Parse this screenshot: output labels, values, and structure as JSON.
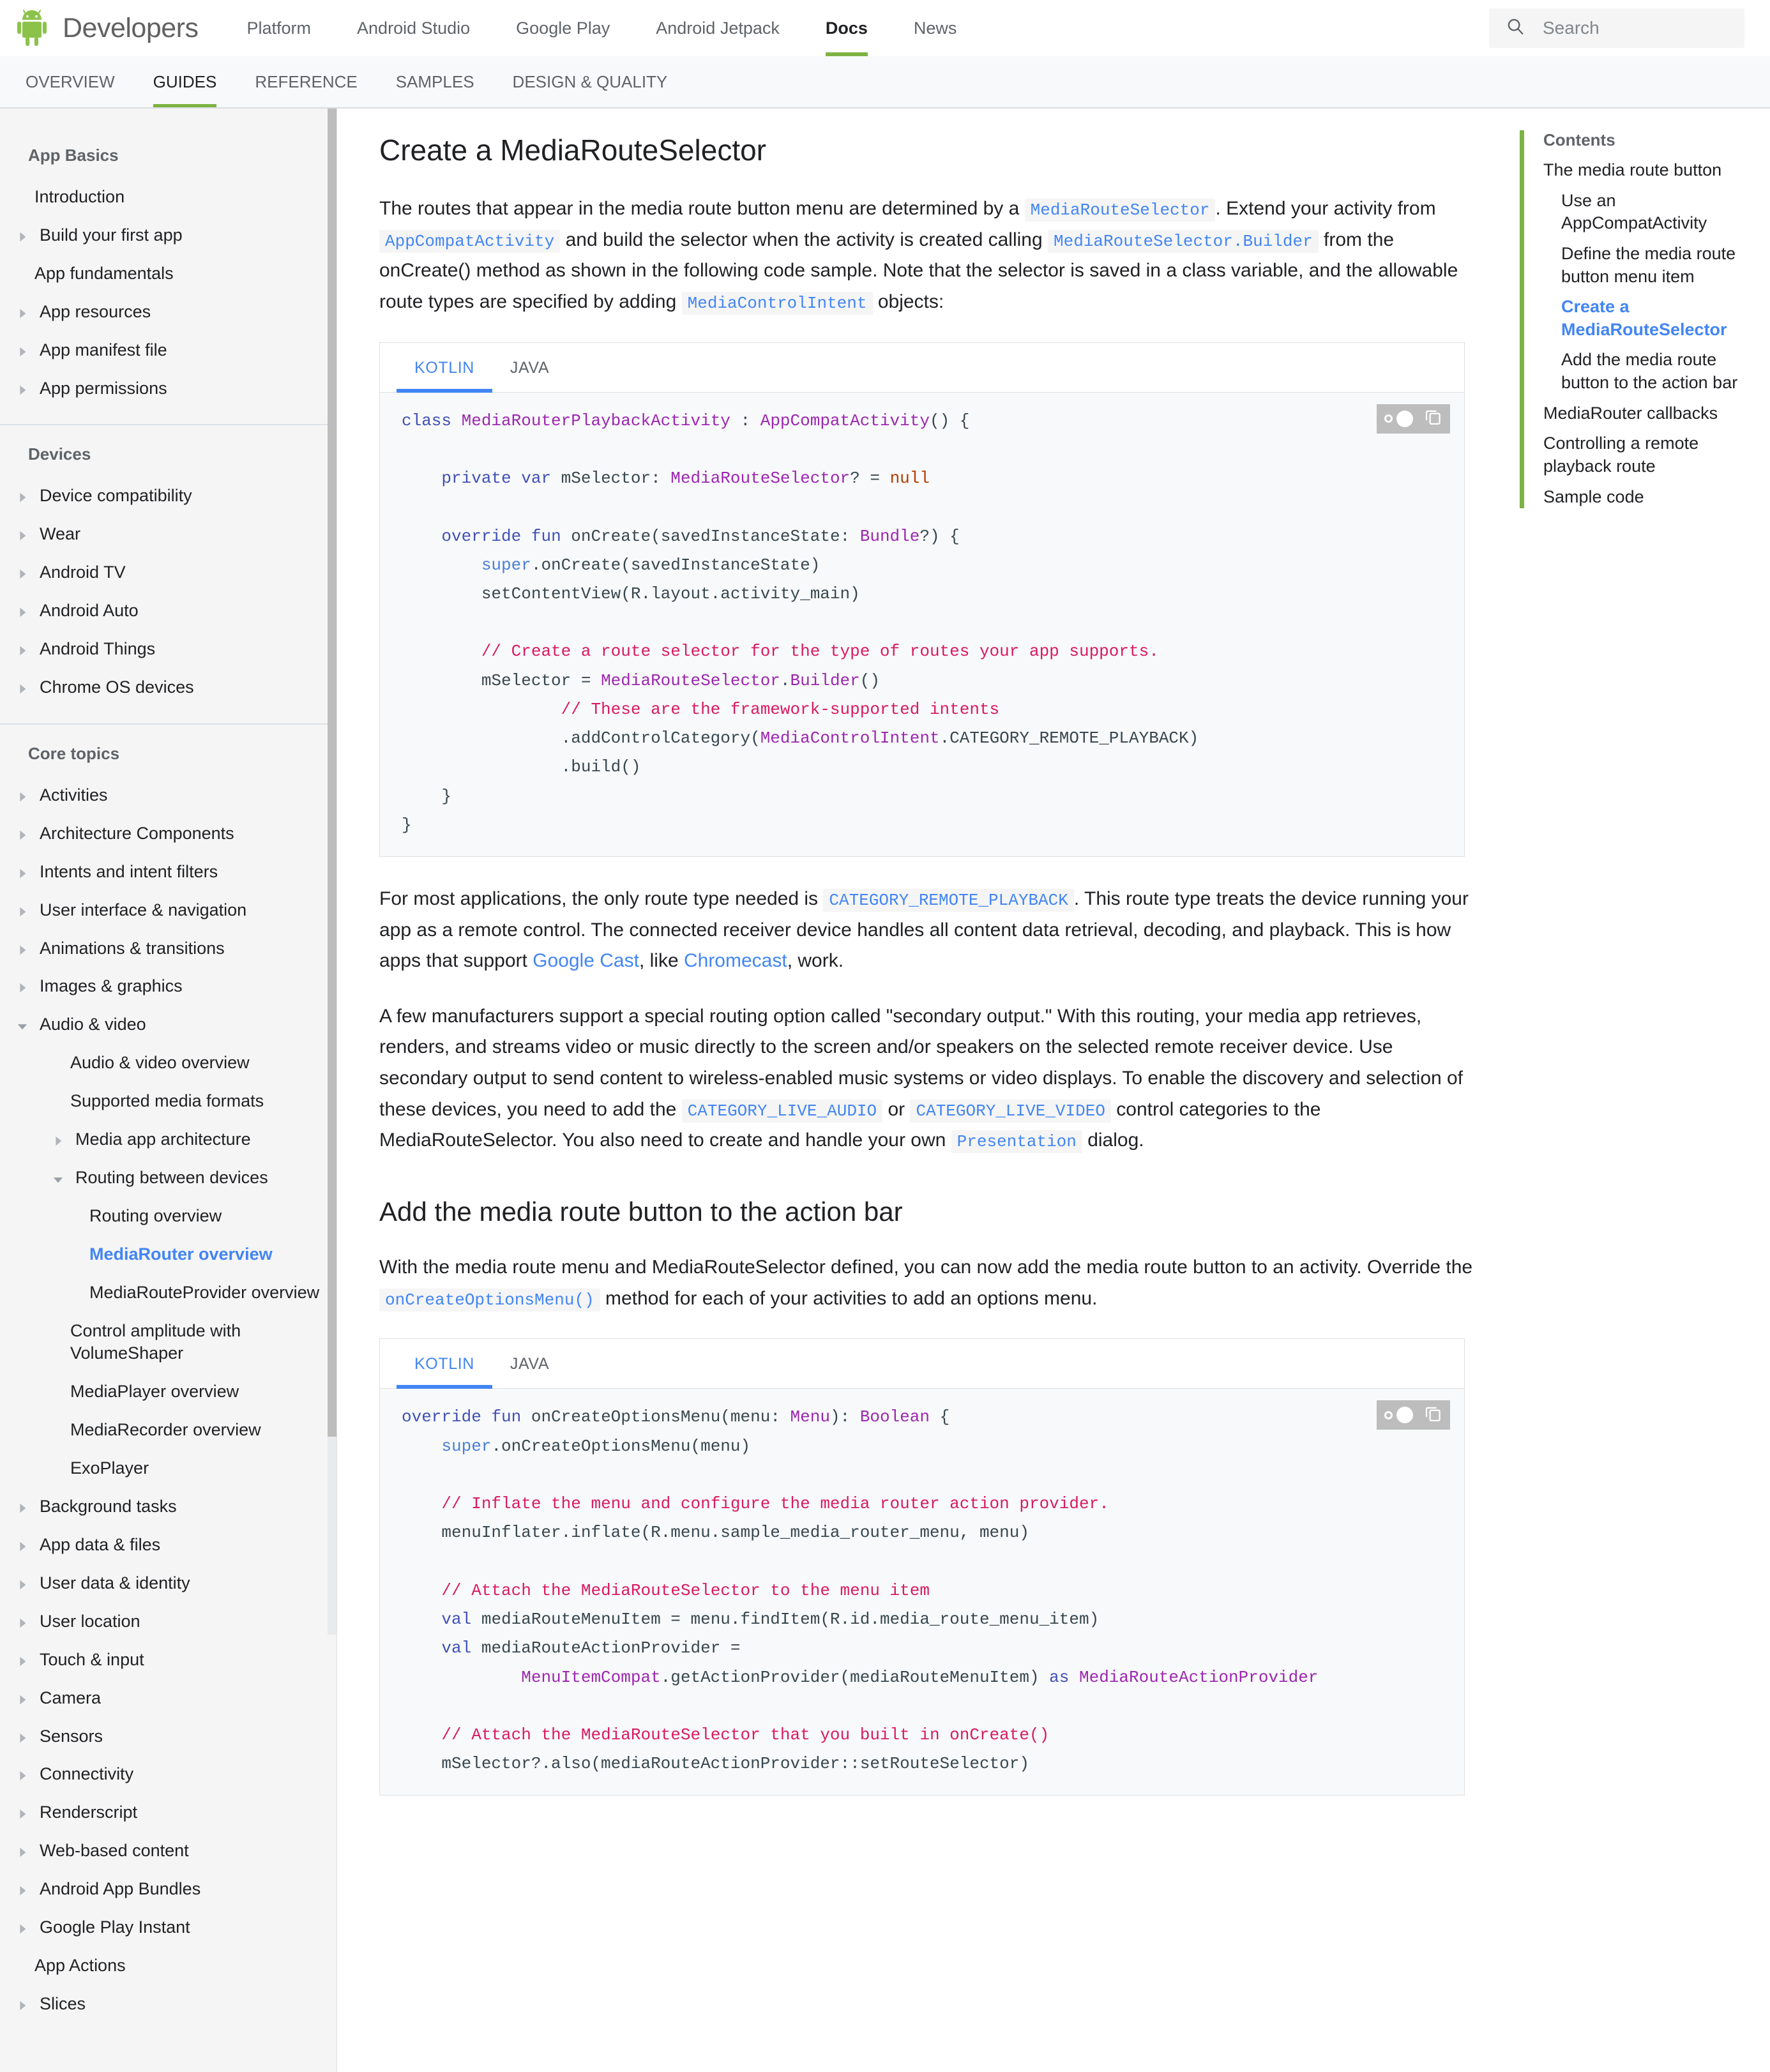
{
  "header": {
    "brand": "Developers",
    "logo_icon": "android-robot-icon",
    "nav": [
      {
        "label": "Platform",
        "active": false
      },
      {
        "label": "Android Studio",
        "active": false
      },
      {
        "label": "Google Play",
        "active": false
      },
      {
        "label": "Android Jetpack",
        "active": false
      },
      {
        "label": "Docs",
        "active": true
      },
      {
        "label": "News",
        "active": false
      }
    ],
    "search": {
      "icon": "search-icon",
      "placeholder": "Search",
      "value": ""
    }
  },
  "subnav": [
    {
      "label": "OVERVIEW",
      "active": false
    },
    {
      "label": "GUIDES",
      "active": true
    },
    {
      "label": "REFERENCE",
      "active": false
    },
    {
      "label": "SAMPLES",
      "active": false
    },
    {
      "label": "DESIGN & QUALITY",
      "active": false
    }
  ],
  "sidebar": {
    "sections": [
      {
        "title": "App Basics",
        "items": [
          {
            "label": "Introduction",
            "level": 0,
            "arrow": "none",
            "selected": false
          },
          {
            "label": "Build your first app",
            "level": 0,
            "arrow": "right",
            "selected": false
          },
          {
            "label": "App fundamentals",
            "level": 0,
            "arrow": "none",
            "selected": false
          },
          {
            "label": "App resources",
            "level": 0,
            "arrow": "right",
            "selected": false
          },
          {
            "label": "App manifest file",
            "level": 0,
            "arrow": "right",
            "selected": false
          },
          {
            "label": "App permissions",
            "level": 0,
            "arrow": "right",
            "selected": false
          }
        ]
      },
      {
        "title": "Devices",
        "items": [
          {
            "label": "Device compatibility",
            "level": 0,
            "arrow": "right",
            "selected": false
          },
          {
            "label": "Wear",
            "level": 0,
            "arrow": "right",
            "selected": false
          },
          {
            "label": "Android TV",
            "level": 0,
            "arrow": "right",
            "selected": false
          },
          {
            "label": "Android Auto",
            "level": 0,
            "arrow": "right",
            "selected": false
          },
          {
            "label": "Android Things",
            "level": 0,
            "arrow": "right",
            "selected": false
          },
          {
            "label": "Chrome OS devices",
            "level": 0,
            "arrow": "right",
            "selected": false
          }
        ]
      },
      {
        "title": "Core topics",
        "items": [
          {
            "label": "Activities",
            "level": 0,
            "arrow": "right",
            "selected": false
          },
          {
            "label": "Architecture Components",
            "level": 0,
            "arrow": "right",
            "selected": false
          },
          {
            "label": "Intents and intent filters",
            "level": 0,
            "arrow": "right",
            "selected": false
          },
          {
            "label": "User interface & navigation",
            "level": 0,
            "arrow": "right",
            "selected": false
          },
          {
            "label": "Animations & transitions",
            "level": 0,
            "arrow": "right",
            "selected": false
          },
          {
            "label": "Images & graphics",
            "level": 0,
            "arrow": "right",
            "selected": false
          },
          {
            "label": "Audio & video",
            "level": 0,
            "arrow": "down",
            "selected": false
          },
          {
            "label": "Audio & video overview",
            "level": 1,
            "arrow": "none",
            "selected": false
          },
          {
            "label": "Supported media formats",
            "level": 1,
            "arrow": "none",
            "selected": false
          },
          {
            "label": "Media app architecture",
            "level": 1,
            "arrow": "right",
            "selected": false
          },
          {
            "label": "Routing between devices",
            "level": 1,
            "arrow": "down",
            "selected": false
          },
          {
            "label": "Routing overview",
            "level": 2,
            "arrow": "none",
            "selected": false
          },
          {
            "label": "MediaRouter overview",
            "level": 2,
            "arrow": "none",
            "selected": true
          },
          {
            "label": "MediaRouteProvider overview",
            "level": 2,
            "arrow": "none",
            "selected": false
          },
          {
            "label": "Control amplitude with VolumeShaper",
            "level": 1,
            "arrow": "none",
            "selected": false
          },
          {
            "label": "MediaPlayer overview",
            "level": 1,
            "arrow": "none",
            "selected": false
          },
          {
            "label": "MediaRecorder overview",
            "level": 1,
            "arrow": "none",
            "selected": false
          },
          {
            "label": "ExoPlayer",
            "level": 1,
            "arrow": "none",
            "selected": false
          },
          {
            "label": "Background tasks",
            "level": 0,
            "arrow": "right",
            "selected": false
          },
          {
            "label": "App data & files",
            "level": 0,
            "arrow": "right",
            "selected": false
          },
          {
            "label": "User data & identity",
            "level": 0,
            "arrow": "right",
            "selected": false
          },
          {
            "label": "User location",
            "level": 0,
            "arrow": "right",
            "selected": false
          },
          {
            "label": "Touch & input",
            "level": 0,
            "arrow": "right",
            "selected": false
          },
          {
            "label": "Camera",
            "level": 0,
            "arrow": "right",
            "selected": false
          },
          {
            "label": "Sensors",
            "level": 0,
            "arrow": "right",
            "selected": false
          },
          {
            "label": "Connectivity",
            "level": 0,
            "arrow": "right",
            "selected": false
          },
          {
            "label": "Renderscript",
            "level": 0,
            "arrow": "right",
            "selected": false
          },
          {
            "label": "Web-based content",
            "level": 0,
            "arrow": "right",
            "selected": false
          },
          {
            "label": "Android App Bundles",
            "level": 0,
            "arrow": "right",
            "selected": false
          },
          {
            "label": "Google Play Instant",
            "level": 0,
            "arrow": "right",
            "selected": false
          },
          {
            "label": "App Actions",
            "level": 0,
            "arrow": "none",
            "selected": false
          },
          {
            "label": "Slices",
            "level": 0,
            "arrow": "right",
            "selected": false
          }
        ]
      }
    ]
  },
  "main": {
    "title": "Create a MediaRouteSelector",
    "p1": {
      "t1": "The routes that appear in the media route button menu are determined by a ",
      "c1": "MediaRouteSelector",
      "t2": ". Extend your activity from ",
      "c2": "AppCompatActivity",
      "t3": " and build the selector when the activity is created calling ",
      "c3": "MediaRouteSelector.Builder",
      "t4": " from the onCreate() method as shown in the following code sample. Note that the selector is saved in a class variable, and the allowable route types are specified by adding ",
      "c4": "MediaControlIntent",
      "t5": " objects:"
    },
    "code1": {
      "tabs": [
        {
          "label": "KOTLIN",
          "active": true
        },
        {
          "label": "JAVA",
          "active": false
        }
      ],
      "actions": {
        "theme_toggle": "dark-mode-toggle-icon",
        "copy": "copy-icon"
      },
      "text": "class MediaRouterPlaybackActivity : AppCompatActivity() {\n\n    private var mSelector: MediaRouteSelector? = null\n\n    override fun onCreate(savedInstanceState: Bundle?) {\n        super.onCreate(savedInstanceState)\n        setContentView(R.layout.activity_main)\n\n        // Create a route selector for the type of routes your app supports.\n        mSelector = MediaRouteSelector.Builder()\n                // These are the framework-supported intents\n                .addControlCategory(MediaControlIntent.CATEGORY_REMOTE_PLAYBACK)\n                .build()\n    }\n}"
    },
    "p2": {
      "t1": "For most applications, the only route type needed is ",
      "c1": "CATEGORY_REMOTE_PLAYBACK",
      "t2": ". This route type treats the device running your app as a remote control. The connected receiver device handles all content data retrieval, decoding, and playback. This is how apps that support ",
      "l1": "Google Cast",
      "t3": ", like ",
      "l2": "Chromecast",
      "t4": ", work."
    },
    "p3": {
      "t1": "A few manufacturers support a special routing option called \"secondary output.\" With this routing, your media app retrieves, renders, and streams video or music directly to the screen and/or speakers on the selected remote receiver device. Use secondary output to send content to wireless-enabled music systems or video displays. To enable the discovery and selection of these devices, you need to add the ",
      "c1": "CATEGORY_LIVE_AUDIO",
      "t2": " or ",
      "c2": "CATEGORY_LIVE_VIDEO",
      "t3": " control categories to the MediaRouteSelector. You also need to create and handle your own ",
      "c3": "Presentation",
      "t4": " dialog."
    },
    "section2_title": "Add the media route button to the action bar",
    "p4": {
      "t1": "With the media route menu and MediaRouteSelector defined, you can now add the media route button to an activity. Override the ",
      "c1": "onCreateOptionsMenu()",
      "t2": " method for each of your activities to add an options menu."
    },
    "code2": {
      "tabs": [
        {
          "label": "KOTLIN",
          "active": true
        },
        {
          "label": "JAVA",
          "active": false
        }
      ],
      "actions": {
        "theme_toggle": "dark-mode-toggle-icon",
        "copy": "copy-icon"
      },
      "text": "override fun onCreateOptionsMenu(menu: Menu): Boolean {\n    super.onCreateOptionsMenu(menu)\n\n    // Inflate the menu and configure the media router action provider.\n    menuInflater.inflate(R.menu.sample_media_router_menu, menu)\n\n    // Attach the MediaRouteSelector to the menu item\n    val mediaRouteMenuItem = menu.findItem(R.id.media_route_menu_item)\n    val mediaRouteActionProvider =\n            MenuItemCompat.getActionProvider(mediaRouteMenuItem) as MediaRouteActionProvider\n\n    // Attach the MediaRouteSelector that you built in onCreate()\n    mSelector?.also(mediaRouteActionProvider::setRouteSelector)"
    }
  },
  "toc": {
    "title": "Contents",
    "items": [
      {
        "label": "The media route button",
        "level": 1,
        "active": false
      },
      {
        "label": "Use an AppCompatActivity",
        "level": 2,
        "active": false
      },
      {
        "label": "Define the media route button menu item",
        "level": 2,
        "active": false
      },
      {
        "label": "Create a MediaRouteSelector",
        "level": 2,
        "active": true
      },
      {
        "label": "Add the media route button to the action bar",
        "level": 2,
        "active": false
      },
      {
        "label": "MediaRouter callbacks",
        "level": 1,
        "active": false
      },
      {
        "label": "Controlling a remote playback route",
        "level": 1,
        "active": false
      },
      {
        "label": "Sample code",
        "level": 1,
        "active": false
      }
    ]
  },
  "colors": {
    "brand_green": "#7cb342",
    "link_blue": "#4285f4",
    "sidebar_bg": "#f5f5f5",
    "code_bg": "#f8f9fa"
  }
}
